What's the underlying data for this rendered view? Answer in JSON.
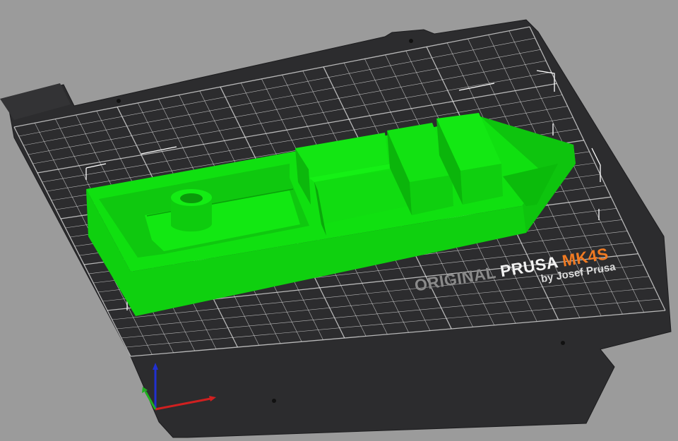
{
  "bed": {
    "brand_original": "ORIGINAL",
    "brand_prusa": "PRUSA",
    "brand_model": "MK4S",
    "brand_byline": "by Josef Prusa"
  },
  "colors": {
    "background": "#9b9b9b",
    "bed_sheet": "#2c2c2e",
    "grid": "#e8e8e8",
    "model": "#12dd12",
    "axis_x": "#d02020",
    "axis_y": "#20b020",
    "axis_z": "#2030d0",
    "accent": "#f07a22"
  },
  "objects": [
    {
      "name": "boat",
      "selected": true
    }
  ]
}
